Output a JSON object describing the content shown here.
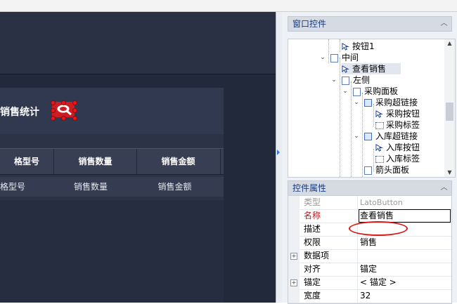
{
  "designer": {
    "panel_title": "销售统计",
    "columns": [
      "格型号",
      "销售数量",
      "销售金额"
    ],
    "row": [
      "格型号",
      "销售数量",
      "销售金额"
    ]
  },
  "window_controls": {
    "title": "窗口控件",
    "tree": [
      {
        "label": "按钮1",
        "icon": "cursor-icon"
      },
      {
        "label": "中间",
        "icon": "page-icon"
      },
      {
        "label": "查看销售",
        "icon": "cursor-icon",
        "selected": true
      },
      {
        "label": "左侧",
        "icon": "page-icon"
      },
      {
        "label": "采购面板",
        "icon": "page-icon"
      },
      {
        "label": "采购超链接",
        "icon": "link-icon"
      },
      {
        "label": "采购按钮",
        "icon": "cursor-icon"
      },
      {
        "label": "采购标签",
        "icon": "label-icon"
      },
      {
        "label": "入库超链接",
        "icon": "link-icon"
      },
      {
        "label": "入库按钮",
        "icon": "cursor-icon"
      },
      {
        "label": "入库标签",
        "icon": "label-icon"
      },
      {
        "label": "箭头面板",
        "icon": "page-icon"
      }
    ]
  },
  "properties": {
    "title": "控件属性",
    "rows": [
      {
        "key": "类型",
        "value": "LatoButton",
        "muted": true
      },
      {
        "key": "名称",
        "value": "查看销售",
        "key_color": "#c0151c",
        "editing": true
      },
      {
        "key": "描述",
        "value": ""
      },
      {
        "key": "权限",
        "value": "销售",
        "highlighted": true
      },
      {
        "key": "数据项",
        "value": "",
        "expandable": true
      },
      {
        "key": "对齐",
        "value": "锚定"
      },
      {
        "key": "锚定",
        "value": "< 锚定 >",
        "expandable": true
      },
      {
        "key": "宽度",
        "value": "32"
      }
    ]
  },
  "colors": {
    "canvas_bg": "#22293a",
    "accent_red": "#d21b1b",
    "pane_title_text": "#1a3a7a"
  }
}
